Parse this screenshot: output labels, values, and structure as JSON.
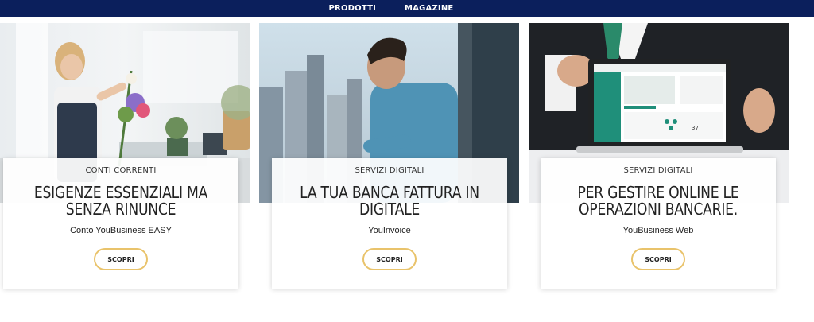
{
  "nav": {
    "items": [
      {
        "label": "PRODOTTI"
      },
      {
        "label": "MAGAZINE"
      }
    ]
  },
  "colors": {
    "nav_bg": "#0b1f5c",
    "button_border": "#e9c36b"
  },
  "cards": [
    {
      "category": "CONTI CORRENTI",
      "title": "ESIGENZE ESSENZIALI MA SENZA RINUNCE",
      "product": "Conto YouBusiness EASY",
      "button": "SCOPRI"
    },
    {
      "category": "SERVIZI DIGITALI",
      "title": "LA TUA BANCA FATTURA IN DIGITALE",
      "product": "YouInvoice",
      "button": "SCOPRI"
    },
    {
      "category": "SERVIZI DIGITALI",
      "title": "PER GESTIRE ONLINE LE OPERAZIONI BANCARIE.",
      "product": "YouBusiness Web",
      "button": "SCOPRI"
    }
  ],
  "laptop_screen": {
    "stat": "37"
  }
}
